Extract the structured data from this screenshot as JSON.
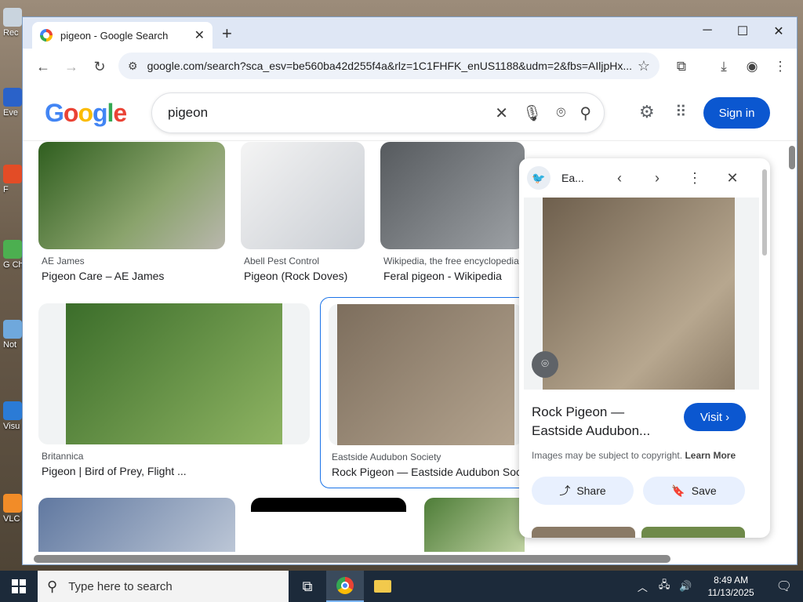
{
  "desktop": {
    "icons": [
      "Rec",
      "Eve",
      "F",
      "G Ch",
      "Not",
      "Visu",
      "VLC P"
    ]
  },
  "browser": {
    "tab_title": "pigeon - Google Search",
    "url": "google.com/search?sca_esv=be560ba42d255f4a&rlz=1C1FHFK_enUS1188&udm=2&fbs=AIljpHx..."
  },
  "google": {
    "logo": "Google",
    "query": "pigeon",
    "sign_in": "Sign in"
  },
  "results": [
    {
      "source": "AE James",
      "caption": "Pigeon Care – AE James"
    },
    {
      "source": "Abell Pest Control",
      "caption": "Pigeon (Rock Doves)"
    },
    {
      "source": "Wikipedia, the free encyclopedia",
      "caption": "Feral pigeon - Wikipedia"
    },
    {
      "source": "Britannica",
      "caption": "Pigeon | Bird of Prey, Flight ..."
    },
    {
      "source": "Eastside Audubon Society",
      "caption": "Rock Pigeon — Eastside Audubon Society"
    }
  ],
  "panel": {
    "site": "Ea...",
    "title": "Rock Pigeon — Eastside Audubon...",
    "visit": "Visit",
    "copyright": "Images may be subject to copyright.",
    "learn_more": "Learn More",
    "share": "Share",
    "save": "Save"
  },
  "taskbar": {
    "search_placeholder": "Type here to search",
    "time": "8:49 AM",
    "date": "11/13/2025"
  },
  "colors": {
    "accent": "#0b57d0",
    "tab_strip": "#dfe7f5",
    "taskbar": "#1c2a3a"
  }
}
